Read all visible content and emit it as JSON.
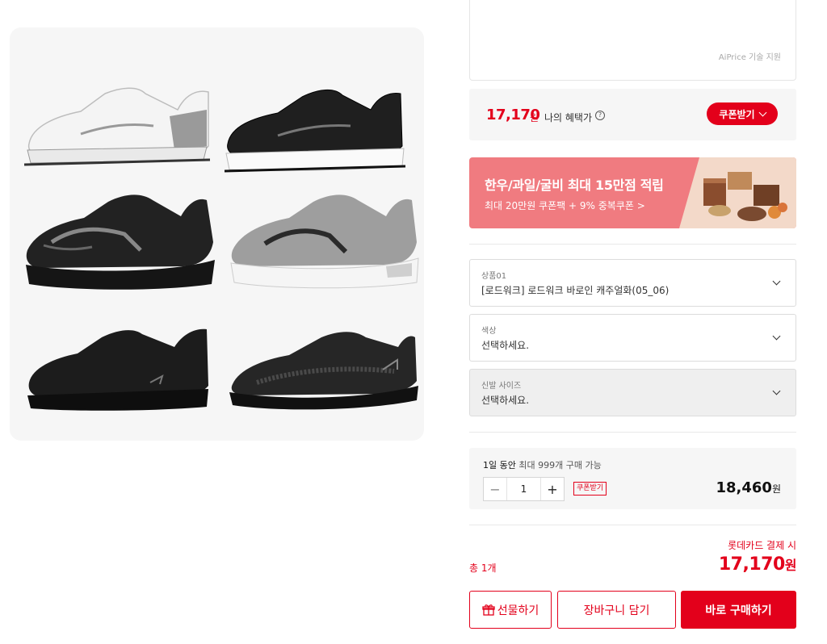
{
  "ai_box": {
    "credit": "AiPrice 기술 지원"
  },
  "benefit": {
    "price": "17,170",
    "unit": "원",
    "label": "나의 혜택가",
    "info_icon": "info-icon",
    "coupon_button": "쿠폰받기"
  },
  "banner": {
    "title": "한우/과일/굴비 최대 15만점 적립",
    "subtitle": "최대 20만원 쿠폰팩 + 9% 중복쿠폰 >"
  },
  "options": [
    {
      "label": "상품01",
      "value": "[로드워크] 로드워크 바로인 캐주얼화(05_06)",
      "disabled": false
    },
    {
      "label": "색상",
      "value": "선택하세요.",
      "disabled": false
    },
    {
      "label": "신발 사이즈",
      "value": "선택하세요.",
      "disabled": true
    }
  ],
  "quantity": {
    "note_prefix": "1일 동안",
    "note_suffix": "최대 999개 구매 가능",
    "minus": "−",
    "value": "1",
    "plus": "+",
    "coupon_tag": "쿠폰받기",
    "price": "18,460",
    "unit": "원"
  },
  "total": {
    "label": "총 1개",
    "card_note": "롯데카드 결제 시",
    "price": "17,170",
    "unit": "원"
  },
  "actions": {
    "gift": "선물하기",
    "cart": "장바구니 담기",
    "buy": "바로 구매하기"
  },
  "colors": {
    "accent": "#e3001b",
    "banner": "#f07b80"
  }
}
